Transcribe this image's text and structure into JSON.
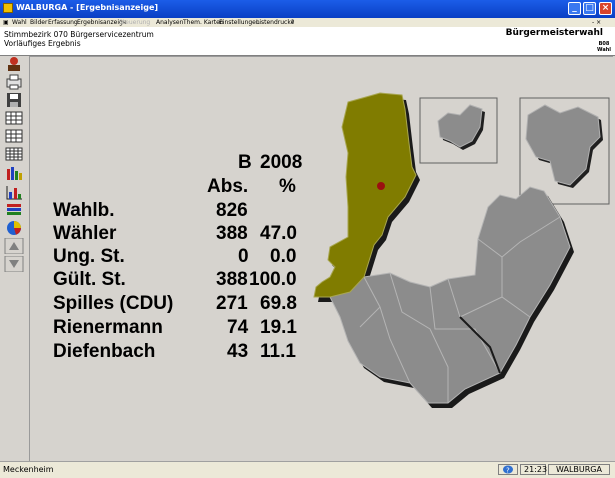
{
  "window": {
    "title": "WALBURGA - [Ergebnisanzeige]",
    "mdi_controls": "- ×"
  },
  "menu": [
    {
      "label": "Wahl",
      "enabled": true
    },
    {
      "label": "Bilder",
      "enabled": true
    },
    {
      "label": "Erfassung",
      "enabled": true
    },
    {
      "label": "Ergebnisanzeige",
      "enabled": true
    },
    {
      "label": "Steuerung",
      "enabled": false
    },
    {
      "label": "Analysen",
      "enabled": true
    },
    {
      "label": "Them. Karten",
      "enabled": true
    },
    {
      "label": "Einstellungen",
      "enabled": true
    },
    {
      "label": "Listendrucke",
      "enabled": true
    },
    {
      "label": "?",
      "enabled": true
    }
  ],
  "header": {
    "district": "Stimmbezirk 070 Bürgerservicezentrum",
    "status": "Vorläufiges Ergebnis",
    "election": "Bürgermeisterwahl",
    "badge_l1": "B08",
    "badge_l2": "Wahl"
  },
  "results": {
    "election_code": "B",
    "year": "2008",
    "col_abs": "Abs.",
    "col_pct": "%",
    "rows": [
      {
        "label": "Wahlb.",
        "abs": "826",
        "pct": ""
      },
      {
        "label": "Wähler",
        "abs": "388",
        "pct": "47.0"
      },
      {
        "label": "Ung. St.",
        "abs": "0",
        "pct": "0.0"
      },
      {
        "label": "Gült. St.",
        "abs": "388",
        "pct": "100.0"
      },
      {
        "label": "Spilles (CDU)",
        "abs": "271",
        "pct": "69.8"
      },
      {
        "label": "Rienermann",
        "abs": "74",
        "pct": "19.1"
      },
      {
        "label": "Diefenbach",
        "abs": "43",
        "pct": "11.1"
      }
    ]
  },
  "colors": {
    "highlight_district": "#807c00",
    "district": "#8c8c8c",
    "marker": "#9b1010",
    "background": "#d6d3ce"
  },
  "toolbar_icons": [
    "user-icon",
    "print-icon",
    "save-icon",
    "grid-icon",
    "grid-icon",
    "grid-icon",
    "bar-chart-icon",
    "bar-chart-icon",
    "layers-icon",
    "pie-chart-icon",
    "arrow-up-icon",
    "arrow-down-icon"
  ],
  "status": {
    "location": "Meckenheim",
    "time": "21:23",
    "app": "WALBURGA"
  }
}
